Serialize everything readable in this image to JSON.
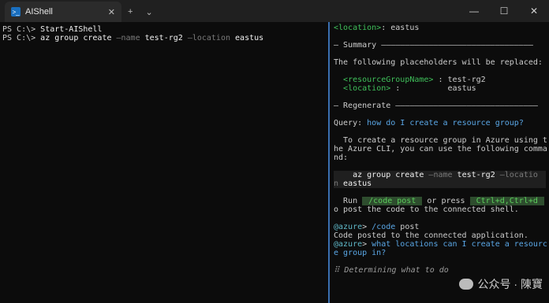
{
  "window": {
    "tab_title": "AIShell",
    "tab_close": "✕",
    "new_tab": "+",
    "dropdown": "⌄",
    "minimize": "—",
    "maximize": "☐",
    "close": "✕"
  },
  "left_pane": {
    "line1_prompt": "PS C:\\> ",
    "line1_cmd": "Start-AIShell",
    "line2_prompt": "PS C:\\> ",
    "line2_cmd": "az group create ",
    "line2_flag1": "—name ",
    "line2_val1": "test-rg2 ",
    "line2_flag2": "—location ",
    "line2_val2": "eastus"
  },
  "right_pane": {
    "location_key": "<location>",
    "location_sep": ": ",
    "location_val": "eastus",
    "summary_header": "— Summary ————————————————————————————————",
    "placeholders_text": "The following placeholders will be replaced:",
    "ph1_key": "<resourceGroupName>",
    "ph1_sep": " : ",
    "ph1_val": "test-rg2",
    "ph2_key": "<location>",
    "ph2_sep": " :          ",
    "ph2_val": "eastus",
    "regenerate_header": "— Regenerate ——————————————————————————————",
    "query_label": "Query: ",
    "query_text": "how do I create a resource group?",
    "answer_line1": "  To create a resource group in Azure using t",
    "answer_line2": "he Azure CLI, you can use the following comma",
    "answer_line3": "nd:",
    "code_cmd": "    az group create ",
    "code_flag1": "—name ",
    "code_val1": "test-rg2 ",
    "code_flag2": "—locatio",
    "code_cont_flag": "n ",
    "code_cont_val": "eastus",
    "run_pre": "  Run ",
    "run_chip1": " /code post ",
    "run_mid": " or press ",
    "run_chip2": " Ctrl+d,Ctrl+d ",
    "run_post": " t",
    "run_line2": "o post the code to the connected shell.",
    "agent_prompt1": "@azure",
    "agent_cmd1_sep": "> ",
    "agent_cmd1_a": "/code ",
    "agent_cmd1_b": "post",
    "posted_msg": "Code posted to the connected application.",
    "agent_prompt2": "@azure",
    "agent_q2_sep": "> ",
    "agent_q2_line1": "what locations can I create a resourc",
    "agent_q2_line2": "e group in?",
    "determining": "⠿ Determining what to do"
  },
  "watermark": {
    "text": "公众号 · 陳寶"
  }
}
